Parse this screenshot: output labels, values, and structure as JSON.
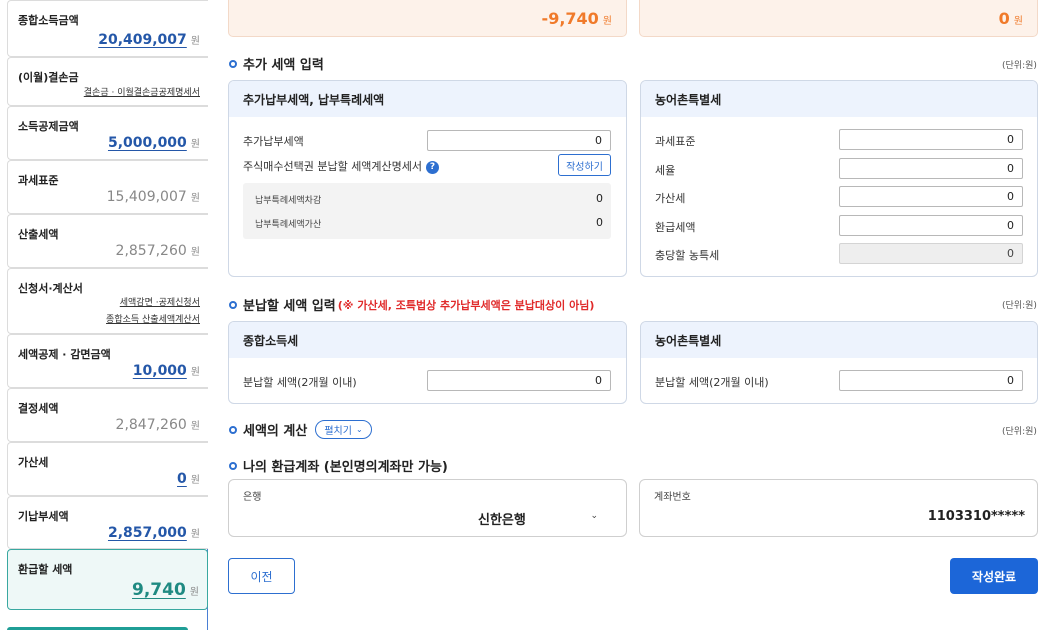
{
  "sidebar": {
    "items": [
      {
        "title": "종합소득금액",
        "value": "20,409,007",
        "unit": "원"
      },
      {
        "title": "(이월)결손금",
        "links": [
          "결손금 · 이월결손금공제명세서"
        ]
      },
      {
        "title": "소득공제금액",
        "value": "5,000,000",
        "unit": "원"
      },
      {
        "title": "과세표준",
        "value": "15,409,007",
        "unit": "원"
      },
      {
        "title": "산출세액",
        "value": "2,857,260",
        "unit": "원"
      },
      {
        "title": "신청서·계산서",
        "links": [
          "세액감면 ·공제신청서",
          "종합소득 산출세액계산서"
        ]
      },
      {
        "title": "세액공제 · 감면금액",
        "value": "10,000",
        "unit": "원"
      },
      {
        "title": "결정세액",
        "value": "2,847,260",
        "unit": "원"
      },
      {
        "title": "가산세",
        "value": "0",
        "unit": "원"
      },
      {
        "title": "기납부세액",
        "value": "2,857,000",
        "unit": "원"
      },
      {
        "title": "환급할 세액",
        "value": "9,740",
        "unit": "원"
      }
    ]
  },
  "top": {
    "left_value": "-9,740",
    "right_value": "0",
    "unit": "원"
  },
  "section_extra": {
    "title": "추가 세액 입력",
    "unit_note": "(단위:원)",
    "left_panel": {
      "title": "추가납부세액, 납부특례세액",
      "row1_label": "추가납부세액",
      "row1_value": "0",
      "row2_label": "주식매수선택권 분납할 세액계산명세서",
      "help_icon": "?",
      "write_button": "작성하기",
      "sub_rows": [
        {
          "label": "납부특례세액차감",
          "value": "0"
        },
        {
          "label": "납부특례세액가산",
          "value": "0"
        }
      ]
    },
    "right_panel": {
      "title": "농어촌특별세",
      "rows": [
        {
          "label": "과세표준",
          "value": "0"
        },
        {
          "label": "세율",
          "value": "0"
        },
        {
          "label": "가산세",
          "value": "0"
        },
        {
          "label": "환급세액",
          "value": "0"
        },
        {
          "label": "충당할 농특세",
          "value": "0"
        }
      ]
    }
  },
  "section_installment": {
    "title": "분납할 세액 입력",
    "note": "(※ 가산세, 조특법상 추가납부세액은 분납대상이 아님)",
    "unit_note": "(단위:원)",
    "left_panel": {
      "title": "종합소득세",
      "label": "분납할 세액(2개월 이내)",
      "value": "0"
    },
    "right_panel": {
      "title": "농어촌특별세",
      "label": "분납할 세액(2개월 이내)",
      "value": "0"
    }
  },
  "section_calc": {
    "title": "세액의 계산",
    "toggle_label": "펼치기",
    "chevron": "⌄",
    "unit_note": "(단위:원)"
  },
  "section_account": {
    "title": "나의 환급계좌 (본인명의계좌만 가능)",
    "bank_label": "은행",
    "bank_value": "신한은행",
    "bank_chevron": "⌄",
    "account_label": "계좌번호",
    "account_value": "1103310*****"
  },
  "buttons": {
    "prev": "이전",
    "done": "작성완료"
  }
}
